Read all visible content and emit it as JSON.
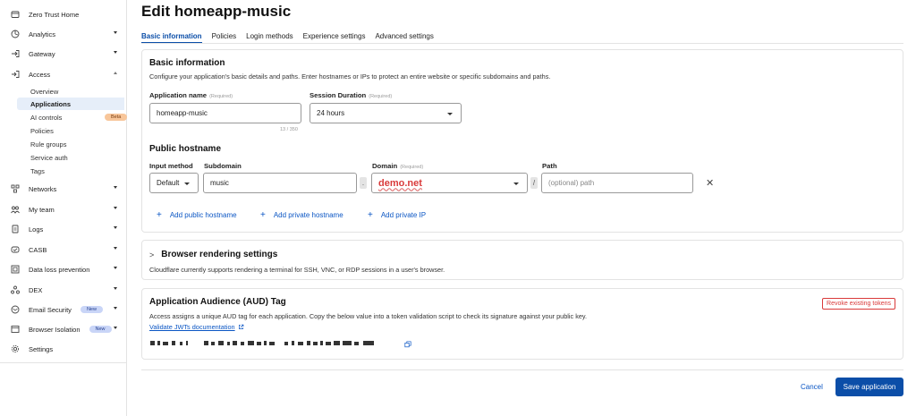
{
  "sidebar": {
    "items": [
      {
        "label": "Zero Trust Home",
        "icon": "home-icon"
      },
      {
        "label": "Analytics",
        "icon": "analytics-icon"
      },
      {
        "label": "Gateway",
        "icon": "gateway-icon"
      },
      {
        "label": "Access",
        "icon": "access-icon"
      },
      {
        "label": "Networks",
        "icon": "networks-icon"
      },
      {
        "label": "My team",
        "icon": "team-icon"
      },
      {
        "label": "Logs",
        "icon": "logs-icon"
      },
      {
        "label": "CASB",
        "icon": "casb-icon"
      },
      {
        "label": "Data loss prevention",
        "icon": "dlp-icon"
      },
      {
        "label": "DEX",
        "icon": "dex-icon"
      },
      {
        "label": "Email Security",
        "icon": "email-icon",
        "badge": "New"
      },
      {
        "label": "Browser Isolation",
        "icon": "browser-icon",
        "badge": "New"
      },
      {
        "label": "Settings",
        "icon": "gear-icon"
      }
    ],
    "access_sub": [
      {
        "label": "Overview"
      },
      {
        "label": "Applications"
      },
      {
        "label": "AI controls",
        "badge": "Beta"
      },
      {
        "label": "Policies"
      },
      {
        "label": "Rule groups"
      },
      {
        "label": "Service auth"
      },
      {
        "label": "Tags"
      }
    ]
  },
  "page": {
    "title": "Edit homeapp-music",
    "tabs": [
      "Basic information",
      "Policies",
      "Login methods",
      "Experience settings",
      "Advanced settings"
    ]
  },
  "basic": {
    "title": "Basic information",
    "desc": "Configure your application's basic details and paths. Enter hostnames or IPs to protect an entire website or specific subdomains and paths.",
    "app_name_label": "Application name",
    "required": "(Required)",
    "app_name_value": "homeapp-music",
    "counter": "13 / 350",
    "session_label": "Session Duration",
    "session_value": "24 hours",
    "public_hostname_title": "Public hostname",
    "input_method_label": "Input method",
    "input_method_value": "Default",
    "subdomain_label": "Subdomain",
    "subdomain_value": "music",
    "domain_label": "Domain",
    "domain_value": "demo.net",
    "dot": ".",
    "slash": "/",
    "path_label": "Path",
    "path_placeholder": "(optional) path",
    "close": "✕",
    "add_public": "Add public hostname",
    "add_private": "Add private hostname",
    "add_ip": "Add private IP",
    "plus": "+"
  },
  "browser": {
    "title": "Browser rendering settings",
    "chevron": ">",
    "desc": "Cloudflare currently supports rendering a terminal for SSH, VNC, or RDP sessions in a user's browser."
  },
  "aud": {
    "title": "Application Audience (AUD) Tag",
    "desc": "Access assigns a unique AUD tag for each application. Copy the below value into a token validation script to check its signature against your public key.",
    "link": "Validate JWTs documentation",
    "revoke": "Revoke existing tokens"
  },
  "footer": {
    "cancel": "Cancel",
    "save": "Save application"
  },
  "colors": {
    "accent": "#0b4ea8",
    "danger": "#d93a3a",
    "active_bg": "#e6eef9"
  }
}
